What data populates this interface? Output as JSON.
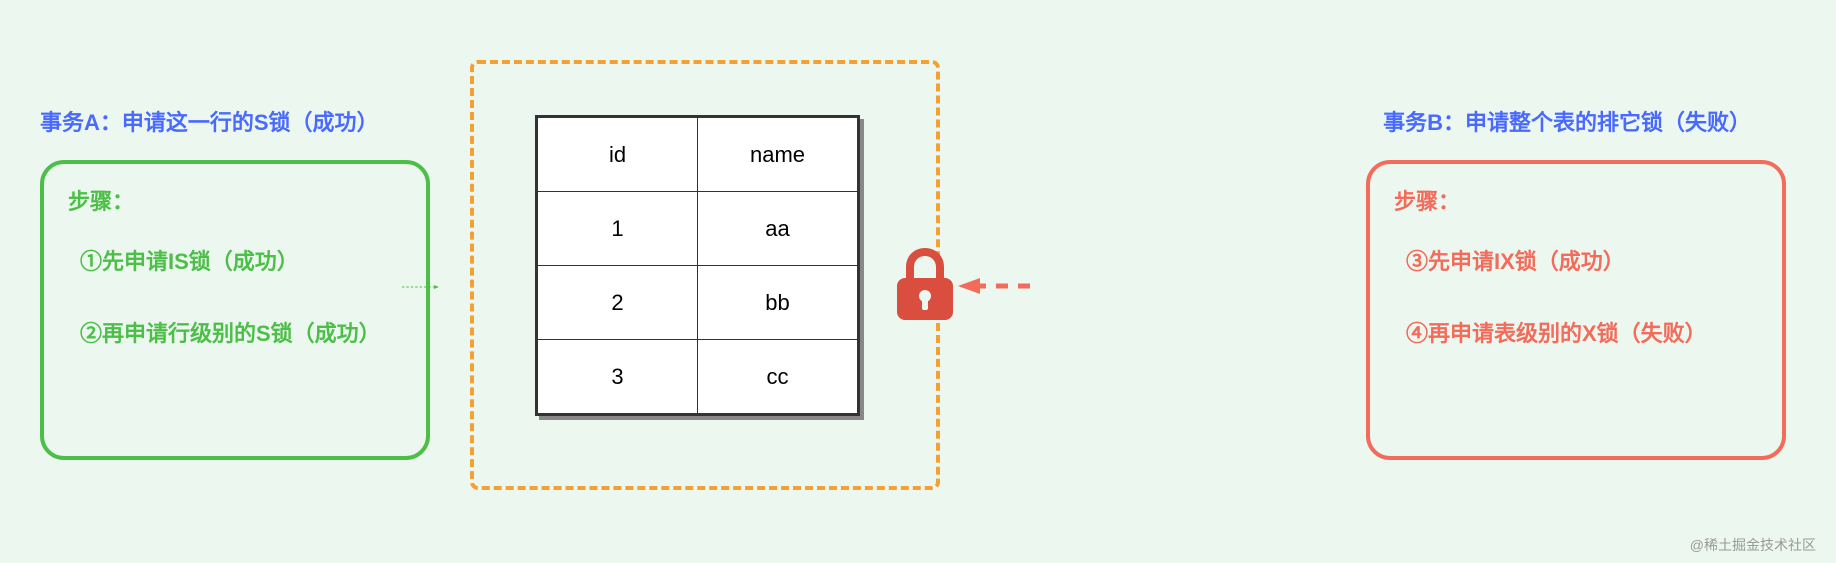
{
  "transactionA": {
    "title": "事务A：申请这一行的S锁（成功）",
    "stepsLabel": "步骤：",
    "step1": "①先申请IS锁（成功）",
    "step2": "②再申请行级别的S锁（成功）"
  },
  "transactionB": {
    "title": "事务B：申请整个表的排它锁（失败）",
    "stepsLabel": "步骤：",
    "step1": "③先申请IX锁（成功）",
    "step2": "④再申请表级别的X锁（失败）"
  },
  "table": {
    "headers": {
      "col1": "id",
      "col2": "name"
    },
    "row1": {
      "col1": "1",
      "col2": "aa"
    },
    "row2": {
      "col1": "2",
      "col2": "bb"
    },
    "row3": {
      "col1": "3",
      "col2": "cc"
    }
  },
  "watermark": "@稀土掘金技术社区",
  "colors": {
    "green": "#4dbf48",
    "red": "#f36b5a",
    "orange": "#f5a032",
    "blue": "#4969ff"
  }
}
